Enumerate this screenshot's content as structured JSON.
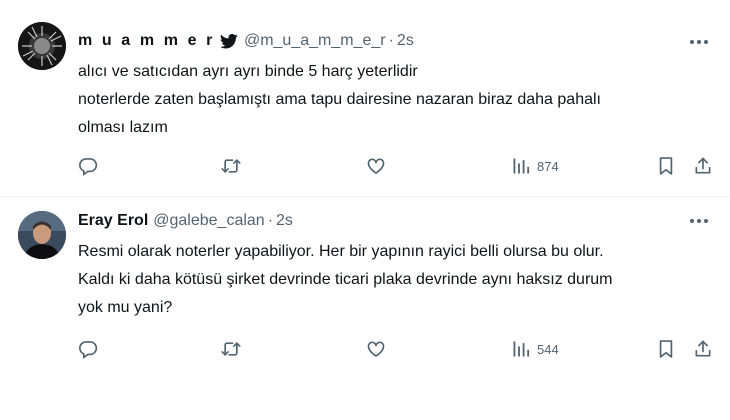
{
  "tweets": [
    {
      "display_name": "m u a m m e r",
      "handle": "@m_u_a_m_m_e_r",
      "separator": "·",
      "time": "2s",
      "text_lines": [
        "alıcı ve satıcıdan ayrı ayrı binde 5 harç yeterlidir",
        "noterlerde zaten başlamıştı ama tapu dairesine nazaran biraz daha pahalı",
        "olması lazım"
      ],
      "views": "874"
    },
    {
      "display_name": "Eray Erol",
      "handle": "@galebe_calan",
      "separator": "·",
      "time": "2s",
      "text_lines": [
        "Resmi olarak noterler yapabiliyor. Her bir yapının rayici belli olursa bu olur.",
        "Kaldı ki daha kötüsü şirket devrinde ticari plaka devrinde aynı haksız durum",
        "yok mu yani?"
      ],
      "views": "544"
    }
  ],
  "icons": {
    "verified_badge": "bird-icon",
    "more": "more-icon",
    "reply": "reply-icon",
    "retweet": "retweet-icon",
    "like": "heart-icon",
    "views": "views-icon",
    "bookmark": "bookmark-icon",
    "share": "share-icon"
  },
  "colors": {
    "text": "#0f1419",
    "muted": "#536471",
    "divider": "#eff3f4"
  }
}
